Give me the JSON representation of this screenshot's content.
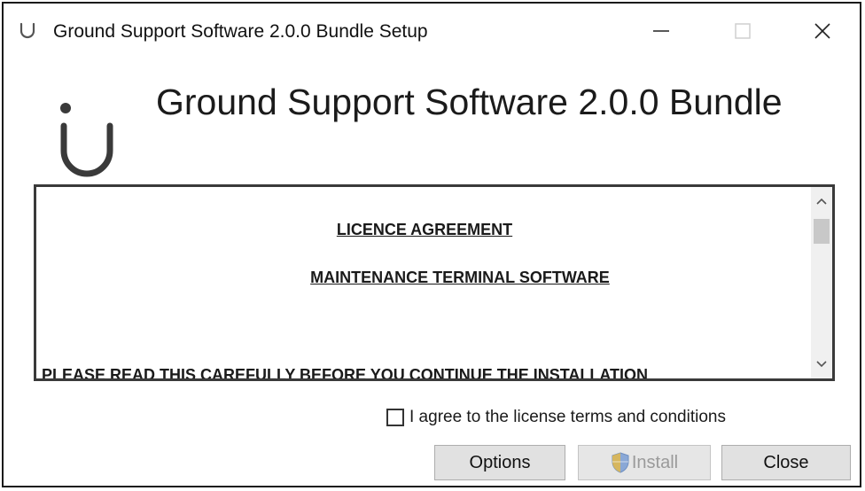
{
  "window": {
    "title": "Ground Support Software 2.0.0 Bundle Setup"
  },
  "header": {
    "title": "Ground Support Software 2.0.0 Bundle"
  },
  "license": {
    "heading": "LICENCE AGREEMENT",
    "subheading": "MAINTENANCE TERMINAL SOFTWARE",
    "body_first_line": "PLEASE READ THIS CAREFULLY BEFORE YOU CONTINUE THE INSTALLATION"
  },
  "agree": {
    "label": "I agree to the license terms and conditions",
    "checked": false
  },
  "buttons": {
    "options": "Options",
    "install": "Install",
    "close": "Close"
  },
  "icons": {
    "app": "app-logo-icon",
    "minimize": "minimize-icon",
    "maximize": "maximize-icon",
    "close": "close-icon",
    "shield": "uac-shield-icon"
  },
  "colors": {
    "window_border": "#1a1a1a",
    "button_face": "#e1e1e1",
    "disabled_text": "#9a9a9a",
    "scrollbar_track": "#f0f0f0"
  }
}
